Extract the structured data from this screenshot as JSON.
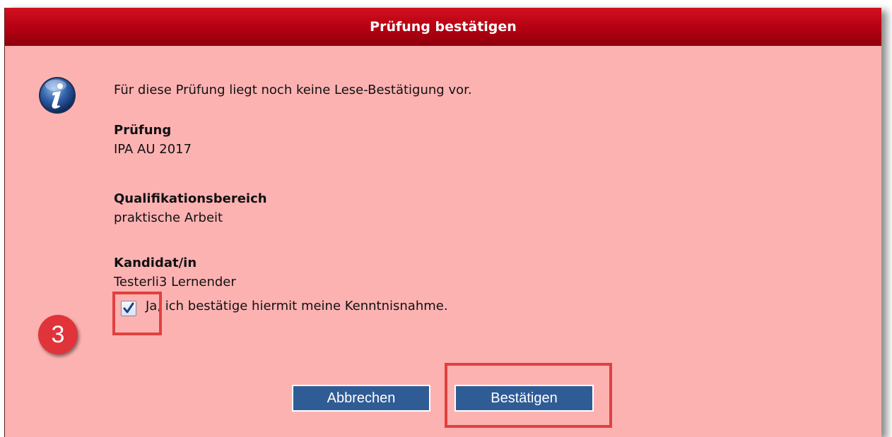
{
  "dialog": {
    "title": "Prüfung bestätigen",
    "icon": "info-icon",
    "message": "Für diese Prüfung liegt noch keine Lese-Bestätigung vor.",
    "fields": [
      {
        "label": "Prüfung",
        "value": "IPA AU 2017"
      },
      {
        "label": "Qualifikationsbereich",
        "value": "praktische Arbeit"
      },
      {
        "label": "Kandidat/in",
        "value": "Testerli3 Lernender"
      }
    ],
    "confirm_checkbox": {
      "checked": true,
      "label": "Ja, ich bestätige hiermit meine Kenntnisnahme."
    },
    "buttons": {
      "cancel": "Abbrechen",
      "confirm": "Bestätigen"
    }
  },
  "annotation": {
    "step_number": "3",
    "highlight_color": "#e0413f"
  },
  "colors": {
    "background": "#fdb2b2",
    "titlebar": "#b40012",
    "button": "#305c95"
  }
}
